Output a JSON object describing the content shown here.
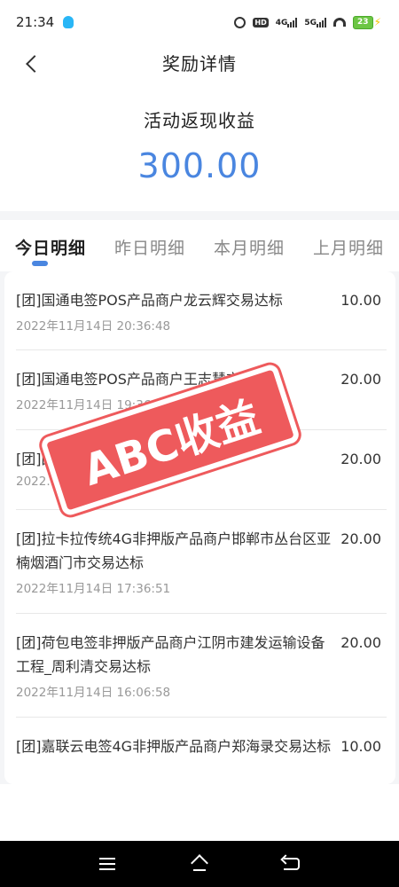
{
  "status_bar": {
    "time": "21:34",
    "network_4g": "4G",
    "network_5g": "5G",
    "hd": "HD",
    "battery": "23"
  },
  "nav": {
    "title": "奖励详情"
  },
  "summary": {
    "label": "活动返现收益",
    "value": "300.00"
  },
  "tabs": [
    {
      "label": "今日明细",
      "active": true
    },
    {
      "label": "昨日明细",
      "active": false
    },
    {
      "label": "本月明细",
      "active": false
    },
    {
      "label": "上月明细",
      "active": false
    }
  ],
  "records": [
    {
      "title": "[团]国通电签POS产品商户龙云辉交易达标",
      "time": "2022年11月14日 20:36:48",
      "amount": "10.00"
    },
    {
      "title": "[团]国通电签POS产品商户王志慧交易达标",
      "time": "2022年11月14日 19:36:48",
      "amount": "20.00"
    },
    {
      "title": "[团]国通传统...交易达标",
      "time": "2022...",
      "amount": "20.00"
    },
    {
      "title": "[团]拉卡拉传统4G非押版产品商户邯郸市丛台区亚楠烟酒门市交易达标",
      "time": "2022年11月14日 17:36:51",
      "amount": "20.00"
    },
    {
      "title": "[团]荷包电签非押版产品商户江阴市建发运输设备工程_周利清交易达标",
      "time": "2022年11月14日 16:06:58",
      "amount": "20.00"
    },
    {
      "title": "[团]嘉联云电签4G非押版产品商户郑海录交易达标",
      "time": "",
      "amount": "10.00"
    }
  ],
  "watermark": {
    "text": "ABC收益"
  },
  "colors": {
    "accent": "#4a86e0",
    "watermark": "#ee5a5c"
  }
}
